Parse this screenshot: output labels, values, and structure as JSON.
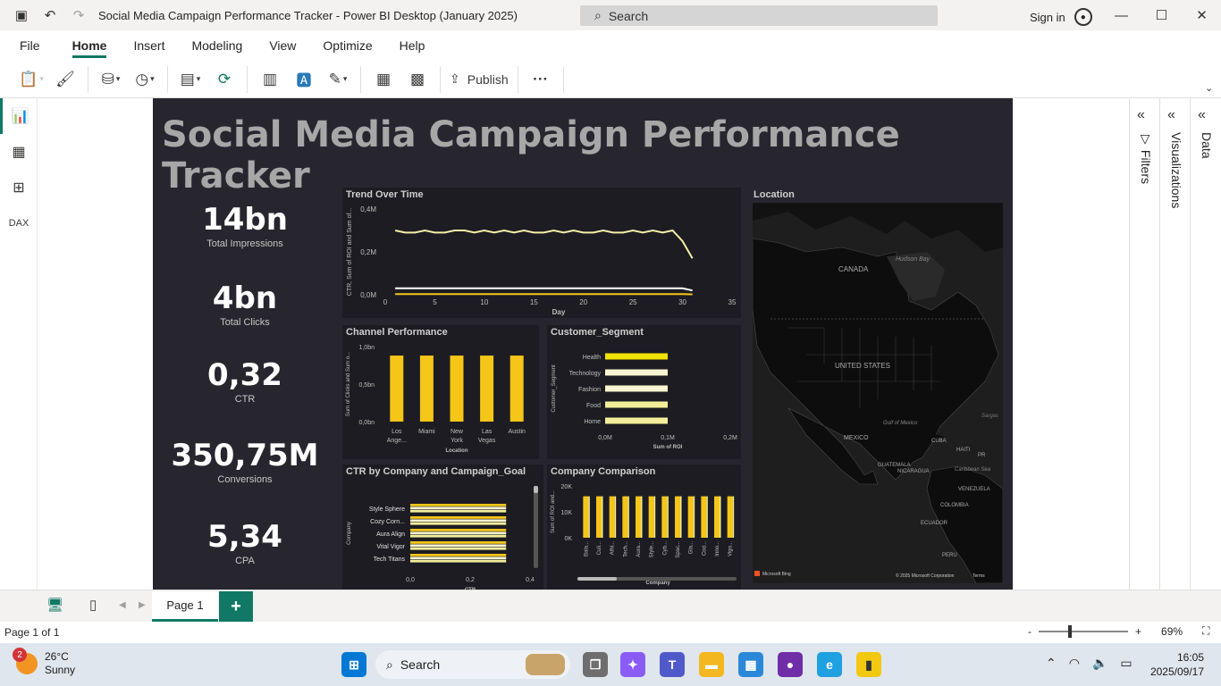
{
  "window": {
    "title": "Social Media Campaign Performance Tracker - Power BI Desktop (January 2025)",
    "search_placeholder": "Search",
    "sign_in": "Sign in"
  },
  "menu": {
    "items": [
      "File",
      "Home",
      "Insert",
      "Modeling",
      "View",
      "Optimize",
      "Help"
    ],
    "active": "Home"
  },
  "ribbon": {
    "publish_label": "Publish",
    "more_label": "···"
  },
  "report": {
    "title": "Social Media Campaign Performance Tracker",
    "kpis": [
      {
        "value": "14bn",
        "label": "Total Impressions"
      },
      {
        "value": "4bn",
        "label": "Total Clicks"
      },
      {
        "value": "0,32",
        "label": "CTR"
      },
      {
        "value": "350,75M",
        "label": "Conversions"
      },
      {
        "value": "5,34",
        "label": "CPA"
      }
    ],
    "map": {
      "title": "Location",
      "labels": [
        "CANADA",
        "Hudson Bay",
        "UNITED STATES",
        "MEXICO",
        "Gulf of Mexico",
        "CUBA",
        "HAITI",
        "Caribbean Sea",
        "GUATEMALA",
        "NICARAGUA",
        "VENEZUELA",
        "COLOMBIA",
        "ECUADOR",
        "PERU",
        "Sargas",
        "PR"
      ],
      "bing": "Microsoft Bing",
      "credit": "© 2025 Microsoft Corporation",
      "terms": "Terms"
    }
  },
  "chart_data": [
    {
      "type": "line",
      "title": "Trend Over Time",
      "xlabel": "Day",
      "ylabel": "CTR, Sum of ROI and Sum of...",
      "xticks": [
        "0",
        "5",
        "10",
        "15",
        "20",
        "25",
        "30",
        "35"
      ],
      "yticks": [
        "0,0M",
        "0,2M",
        "0,4M"
      ],
      "xlim": [
        0,
        35
      ],
      "ylim": [
        0,
        0.4
      ],
      "x": [
        1,
        2,
        3,
        4,
        5,
        6,
        7,
        8,
        9,
        10,
        11,
        12,
        13,
        14,
        15,
        16,
        17,
        18,
        19,
        20,
        21,
        22,
        23,
        24,
        25,
        26,
        27,
        28,
        29,
        30,
        31
      ],
      "series": [
        {
          "color": "#f2f0a8",
          "values": [
            0.3,
            0.29,
            0.29,
            0.3,
            0.29,
            0.29,
            0.3,
            0.3,
            0.29,
            0.3,
            0.29,
            0.3,
            0.29,
            0.3,
            0.29,
            0.29,
            0.3,
            0.29,
            0.3,
            0.29,
            0.29,
            0.3,
            0.29,
            0.29,
            0.3,
            0.29,
            0.3,
            0.29,
            0.3,
            0.25,
            0.17
          ]
        },
        {
          "color": "#ffffff",
          "values": [
            0.03,
            0.03,
            0.03,
            0.03,
            0.03,
            0.03,
            0.03,
            0.03,
            0.03,
            0.03,
            0.03,
            0.03,
            0.03,
            0.03,
            0.03,
            0.03,
            0.03,
            0.03,
            0.03,
            0.03,
            0.03,
            0.03,
            0.03,
            0.03,
            0.03,
            0.03,
            0.03,
            0.03,
            0.03,
            0.03,
            0.02
          ]
        },
        {
          "color": "#f5c518",
          "values": [
            0.003,
            0.003,
            0.003,
            0.003,
            0.003,
            0.003,
            0.003,
            0.003,
            0.003,
            0.003,
            0.003,
            0.003,
            0.003,
            0.003,
            0.003,
            0.003,
            0.003,
            0.003,
            0.003,
            0.003,
            0.003,
            0.003,
            0.003,
            0.003,
            0.003,
            0.003,
            0.003,
            0.003,
            0.003,
            0.003,
            0.002
          ]
        }
      ]
    },
    {
      "type": "bar",
      "title": "Channel Performance",
      "xlabel": "Location",
      "ylabel": "Sum of Clicks and Sum o...",
      "categories": [
        "Los Ange...",
        "Miami",
        "New York",
        "Las Vegas",
        "Austin"
      ],
      "yticks": [
        "0,0bn",
        "0,5bn",
        "1,0bn"
      ],
      "ylim": [
        0,
        1.0
      ],
      "values": [
        0.88,
        0.88,
        0.88,
        0.88,
        0.88
      ],
      "color": "#f5c518"
    },
    {
      "type": "bar",
      "orientation": "horizontal",
      "title": "Customer_Segment",
      "xlabel": "Sum of ROI",
      "ylabel": "Customer_Segment",
      "categories": [
        "Health",
        "Technology",
        "Fashion",
        "Food",
        "Home"
      ],
      "xticks": [
        "0,0M",
        "0,1M",
        "0,2M"
      ],
      "xlim": [
        0,
        0.2
      ],
      "values": [
        0.1,
        0.1,
        0.1,
        0.1,
        0.1
      ],
      "colors": [
        "#f2e200",
        "#f8f4cf",
        "#f8f4cf",
        "#f2ee9a",
        "#f2ee9a"
      ]
    },
    {
      "type": "bar",
      "orientation": "horizontal",
      "title": "CTR by Company and Campaign_Goal",
      "xlabel": "CTR",
      "ylabel": "Company",
      "categories": [
        "Style Sphere",
        "Cozy Corn...",
        "Aura Align",
        "Vital Vigor",
        "Tech Titans"
      ],
      "xticks": [
        "0,0",
        "0,2",
        "0,4"
      ],
      "xlim": [
        0,
        0.4
      ],
      "values": [
        0.32,
        0.32,
        0.32,
        0.32,
        0.32
      ]
    },
    {
      "type": "bar",
      "title": "Company Comparison",
      "xlabel": "Company",
      "ylabel": "Sum of ROI and...",
      "categories": [
        "Bala...",
        "Culi...",
        "Athl...",
        "Tech...",
        "Aura...",
        "Style...",
        "Cyb...",
        "Spac...",
        "Gla...",
        "Cod...",
        "Inno...",
        "Vigo..."
      ],
      "yticks": [
        "0K",
        "10K",
        "20K"
      ],
      "ylim": [
        0,
        20
      ],
      "values": [
        16,
        16,
        16,
        16,
        16,
        16,
        16,
        16,
        16,
        16,
        16,
        16
      ],
      "color": "#f5c518"
    }
  ],
  "panes": {
    "filters": "Filters",
    "visualizations": "Visualizations",
    "data": "Data"
  },
  "pages": {
    "tab": "Page 1",
    "status": "Page 1 of 1",
    "zoom": "69%",
    "zoom_value": 0.69
  },
  "taskbar": {
    "temp": "26°C",
    "cond": "Sunny",
    "badge": "2",
    "search": "Search",
    "time": "16:05",
    "date": "2025/09/17"
  },
  "colors": {
    "accent": "#117865",
    "report_bg": "#27262f",
    "panel_bg": "#1c1c22",
    "gold": "#f5c518"
  }
}
